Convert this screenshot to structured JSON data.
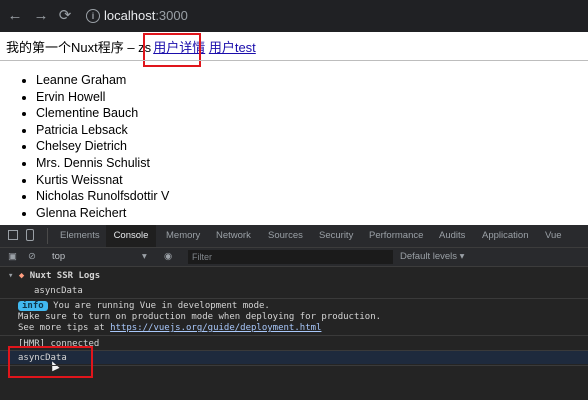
{
  "browser": {
    "url_host": "localhost",
    "url_port": ":3000",
    "icons": [
      "back-icon",
      "forward-icon",
      "reload-icon",
      "site-info-icon"
    ]
  },
  "page": {
    "header_text": "我的第一个Nuxt程序 – zs",
    "link_user_detail": "用户详情",
    "link_user_test": "用户test",
    "users": [
      "Leanne Graham",
      "Ervin Howell",
      "Clementine Bauch",
      "Patricia Lebsack",
      "Chelsey Dietrich",
      "Mrs. Dennis Schulist",
      "Kurtis Weissnat",
      "Nicholas Runolfsdottir V",
      "Glenna Reichert"
    ]
  },
  "devtools": {
    "tabs": [
      "Elements",
      "Console",
      "Memory",
      "Network",
      "Sources",
      "Security",
      "Performance",
      "Audits",
      "Application",
      "Vue"
    ],
    "active_tab": "Console",
    "context": "top",
    "filter_placeholder": "Filter",
    "levels": "Default levels ▾",
    "console": {
      "group_title": "Nuxt SSR Logs",
      "group_item": "asyncData",
      "info_badge": "info",
      "info_line1": "You are running Vue in development mode.",
      "info_line2": "Make sure to turn on production mode when deploying for production.",
      "info_line3_prefix": "See more tips at ",
      "info_link": "https://vuejs.org/guide/deployment.html",
      "hmr": "[HMR] connected",
      "last_log": "asyncData"
    }
  },
  "colors": {
    "highlight_box": "#e0151b",
    "info_badge": "#41b9f0",
    "devtools_bg": "#242424"
  }
}
